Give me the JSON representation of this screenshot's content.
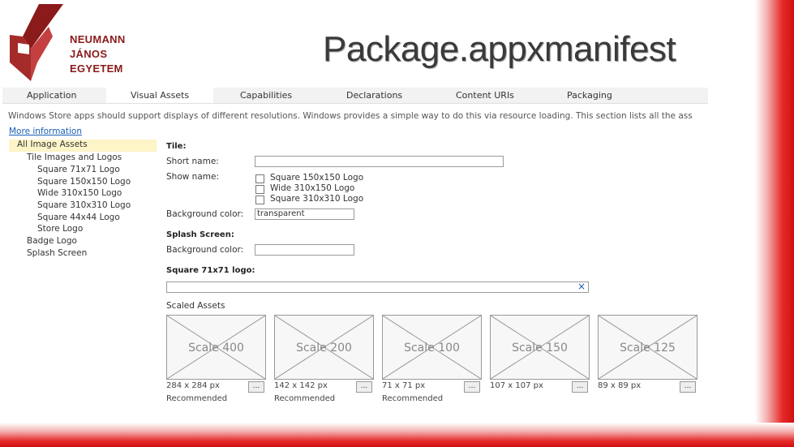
{
  "logo": {
    "line1": "NEUMANN",
    "line2": "JÁNOS",
    "line3": "EGYETEM",
    "accent": "#8b1a1a"
  },
  "slide_title": "Package.appxmanifest",
  "tabs": [
    {
      "label": "Application"
    },
    {
      "label": "Visual Assets"
    },
    {
      "label": "Capabilities"
    },
    {
      "label": "Declarations"
    },
    {
      "label": "Content URIs"
    },
    {
      "label": "Packaging"
    }
  ],
  "description": "Windows Store apps should support displays of different resolutions. Windows provides a simple way to do this via resource loading. This section lists all the ass",
  "more_info": "More information",
  "tree": [
    {
      "label": "All Image Assets"
    },
    {
      "label": "Tile Images and Logos"
    },
    {
      "label": "Square 71x71 Logo"
    },
    {
      "label": "Square 150x150 Logo"
    },
    {
      "label": "Wide 310x150 Logo"
    },
    {
      "label": "Square 310x310 Logo"
    },
    {
      "label": "Square 44x44 Logo"
    },
    {
      "label": "Store Logo"
    },
    {
      "label": "Badge Logo"
    },
    {
      "label": "Splash Screen"
    }
  ],
  "tile": {
    "heading": "Tile:",
    "short_name_label": "Short name:",
    "short_name_value": "",
    "show_name_label": "Show name:",
    "options": [
      {
        "label": "Square 150x150 Logo"
      },
      {
        "label": "Wide 310x150 Logo"
      },
      {
        "label": "Square 310x310 Logo"
      }
    ],
    "bg_label": "Background color:",
    "bg_value": "transparent"
  },
  "splash": {
    "heading": "Splash Screen:",
    "bg_label": "Background color:",
    "bg_value": ""
  },
  "square71": {
    "heading": "Square 71x71 logo:",
    "clear_icon": "×"
  },
  "scaled_assets_label": "Scaled Assets",
  "assets": [
    {
      "scale": "Scale 400",
      "size": "284 x 284 px",
      "rec": "Recommended"
    },
    {
      "scale": "Scale 200",
      "size": "142 x 142 px",
      "rec": "Recommended"
    },
    {
      "scale": "Scale 100",
      "size": "71 x 71 px",
      "rec": "Recommended"
    },
    {
      "scale": "Scale 150",
      "size": "107 x 107 px",
      "rec": ""
    },
    {
      "scale": "Scale 125",
      "size": "89 x 89 px",
      "rec": ""
    }
  ],
  "browse_label": "..."
}
